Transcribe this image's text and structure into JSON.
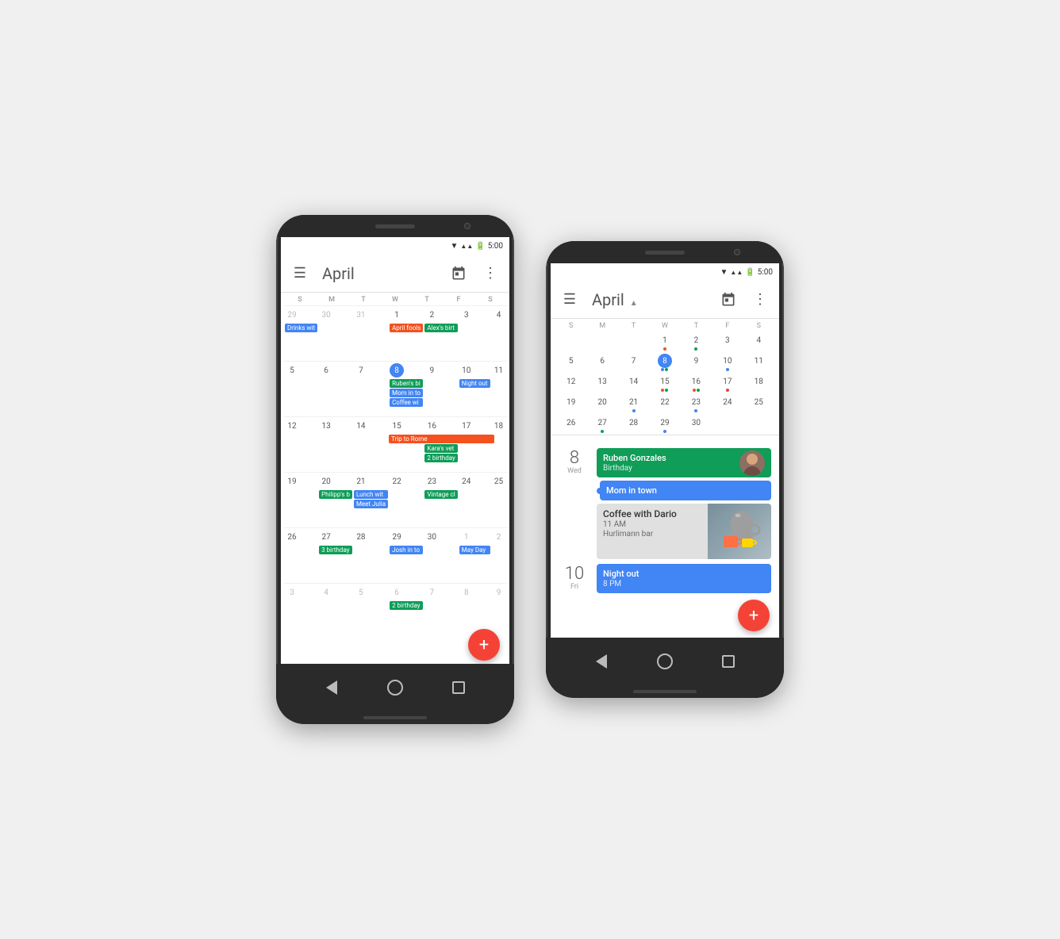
{
  "phone1": {
    "status": "5:00",
    "header": {
      "menu_icon": "☰",
      "title": "April",
      "cal_icon": "📅",
      "more_icon": "⋮"
    },
    "day_headers": [
      "S",
      "M",
      "T",
      "W",
      "T",
      "F",
      "S"
    ],
    "weeks": [
      {
        "days": [
          {
            "num": "29",
            "muted": true,
            "events": []
          },
          {
            "num": "30",
            "muted": true,
            "events": []
          },
          {
            "num": "31",
            "muted": true,
            "events": []
          },
          {
            "num": "1",
            "events": [
              {
                "label": "April fools",
                "color": "chip-orange"
              }
            ]
          },
          {
            "num": "2",
            "events": [
              {
                "label": "Alex's birt",
                "color": "chip-green"
              }
            ]
          },
          {
            "num": "3",
            "events": []
          },
          {
            "num": "4",
            "events": []
          }
        ]
      },
      {
        "days": [
          {
            "num": "5",
            "events": []
          },
          {
            "num": "6",
            "events": []
          },
          {
            "num": "7",
            "events": []
          },
          {
            "num": "8",
            "today": true,
            "events": [
              {
                "label": "Ruben's bi",
                "color": "chip-green"
              },
              {
                "label": "Mom in to",
                "color": "chip-blue"
              },
              {
                "label": "Coffee wi",
                "color": "chip-blue"
              }
            ]
          },
          {
            "num": "9",
            "events": []
          },
          {
            "num": "10",
            "events": [
              {
                "label": "Night out",
                "color": "chip-blue"
              }
            ]
          },
          {
            "num": "11",
            "events": []
          }
        ]
      },
      {
        "days": [
          {
            "num": "12",
            "events": []
          },
          {
            "num": "13",
            "events": []
          },
          {
            "num": "14",
            "events": []
          },
          {
            "num": "15",
            "events": [
              {
                "label": "Trip to Rome",
                "color": "chip-orange",
                "span": true
              }
            ]
          },
          {
            "num": "16",
            "events": [
              {
                "label": "Kara's vet",
                "color": "chip-green"
              },
              {
                "label": "2 birthday",
                "color": "chip-green"
              }
            ]
          },
          {
            "num": "17",
            "events": []
          },
          {
            "num": "18",
            "events": []
          }
        ]
      },
      {
        "days": [
          {
            "num": "19",
            "events": []
          },
          {
            "num": "20",
            "events": [
              {
                "label": "Philipp's b",
                "color": "chip-green"
              }
            ]
          },
          {
            "num": "21",
            "events": [
              {
                "label": "Lunch wit",
                "color": "chip-blue"
              },
              {
                "label": "Meet Julia",
                "color": "chip-blue"
              }
            ]
          },
          {
            "num": "22",
            "events": []
          },
          {
            "num": "23",
            "events": [
              {
                "label": "Vintage cl",
                "color": "chip-green"
              }
            ]
          },
          {
            "num": "24",
            "events": []
          },
          {
            "num": "25",
            "events": []
          }
        ]
      },
      {
        "days": [
          {
            "num": "26",
            "events": []
          },
          {
            "num": "27",
            "events": [
              {
                "label": "3 birthday",
                "color": "chip-green"
              }
            ]
          },
          {
            "num": "28",
            "events": []
          },
          {
            "num": "29",
            "events": [
              {
                "label": "Josh in to",
                "color": "chip-blue"
              }
            ]
          },
          {
            "num": "30",
            "events": []
          },
          {
            "num": "1",
            "muted": true,
            "events": [
              {
                "label": "May Day",
                "color": "chip-blue"
              }
            ]
          },
          {
            "num": "2",
            "muted": true,
            "events": []
          }
        ]
      },
      {
        "days": [
          {
            "num": "3",
            "muted": true,
            "events": []
          },
          {
            "num": "4",
            "muted": true,
            "events": []
          },
          {
            "num": "5",
            "muted": true,
            "events": []
          },
          {
            "num": "6",
            "muted": true,
            "events": [
              {
                "label": "2 birthday",
                "color": "chip-green"
              }
            ]
          },
          {
            "num": "7",
            "muted": true,
            "events": []
          },
          {
            "num": "8",
            "muted": true,
            "events": []
          },
          {
            "num": "9",
            "muted": true,
            "events": []
          }
        ]
      }
    ],
    "drinks_event": "Drinks wit",
    "fab_label": "+"
  },
  "phone2": {
    "status": "5:00",
    "header": {
      "menu_icon": "☰",
      "title": "April",
      "arrow_icon": "▲",
      "cal_icon": "📅",
      "more_icon": "⋮"
    },
    "mini_cal": {
      "day_headers": [
        "S",
        "M",
        "T",
        "W",
        "T",
        "F",
        "S"
      ],
      "weeks": [
        {
          "days": [
            {
              "num": "",
              "muted": true
            },
            {
              "num": "",
              "muted": true
            },
            {
              "num": "",
              "muted": true
            },
            {
              "num": "1",
              "dots": [
                "dot-orange"
              ]
            },
            {
              "num": "2",
              "dots": [
                "dot-green"
              ]
            },
            {
              "num": "3"
            },
            {
              "num": "4"
            }
          ]
        },
        {
          "days": [
            {
              "num": "5"
            },
            {
              "num": "6"
            },
            {
              "num": "7"
            },
            {
              "num": "8",
              "today": true,
              "dots": [
                "dot-blue",
                "dot-green"
              ]
            },
            {
              "num": "9"
            },
            {
              "num": "10",
              "dots": [
                "dot-blue"
              ]
            },
            {
              "num": "11"
            }
          ]
        },
        {
          "days": [
            {
              "num": "12"
            },
            {
              "num": "13"
            },
            {
              "num": "14"
            },
            {
              "num": "15",
              "dots": [
                "dot-orange",
                "dot-green"
              ]
            },
            {
              "num": "16",
              "dots": [
                "dot-orange",
                "dot-green"
              ]
            },
            {
              "num": "17",
              "dots": [
                "dot-red"
              ]
            },
            {
              "num": "18"
            }
          ]
        },
        {
          "days": [
            {
              "num": "19"
            },
            {
              "num": "20"
            },
            {
              "num": "21",
              "dots": [
                "dot-blue"
              ]
            },
            {
              "num": "22"
            },
            {
              "num": "23",
              "dots": [
                "dot-blue"
              ]
            },
            {
              "num": "24"
            },
            {
              "num": "25"
            }
          ]
        },
        {
          "days": [
            {
              "num": "26"
            },
            {
              "num": "27",
              "dots": [
                "dot-green"
              ]
            },
            {
              "num": "28"
            },
            {
              "num": "29",
              "dots": [
                "dot-blue"
              ]
            },
            {
              "num": "30"
            }
          ]
        }
      ]
    },
    "schedule": [
      {
        "date_num": "8",
        "date_day": "Wed",
        "events": [
          {
            "type": "green",
            "title": "Ruben Gonzales",
            "subtitle": "Birthday",
            "has_avatar": true
          },
          {
            "type": "blue",
            "title": "Mom in town",
            "subtitle": "",
            "has_dot": true
          },
          {
            "type": "gray-card",
            "title": "Coffee with Dario",
            "subtitle": "11 AM",
            "location": "Hurlimann bar",
            "has_image": true
          }
        ]
      },
      {
        "date_num": "10",
        "date_day": "Fri",
        "events": [
          {
            "type": "blue",
            "title": "Night out",
            "subtitle": "8 PM"
          }
        ]
      }
    ],
    "fab_label": "+"
  }
}
